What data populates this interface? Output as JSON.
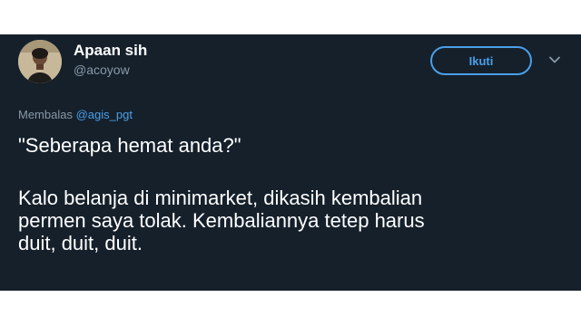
{
  "tweet": {
    "author": {
      "display_name": "Apaan sih",
      "handle": "@acoyow"
    },
    "follow_label": "Ikuti",
    "reply": {
      "prefix": "Membalas",
      "mention": "@agis_pgt"
    },
    "text": {
      "line1": "\"Seberapa hemat anda?\"",
      "line2": "Kalo belanja di minimarket, dikasih kembalian",
      "line3": "permen saya tolak. Kembaliannya tetep harus",
      "line4": "duit, duit, duit."
    }
  },
  "colors": {
    "background": "#15202b",
    "accent": "#4a9fe8",
    "secondary_text": "#8899a6",
    "primary_text": "#ffffff"
  },
  "icons": {
    "more": "chevron-down-icon",
    "avatar": "avatar"
  }
}
